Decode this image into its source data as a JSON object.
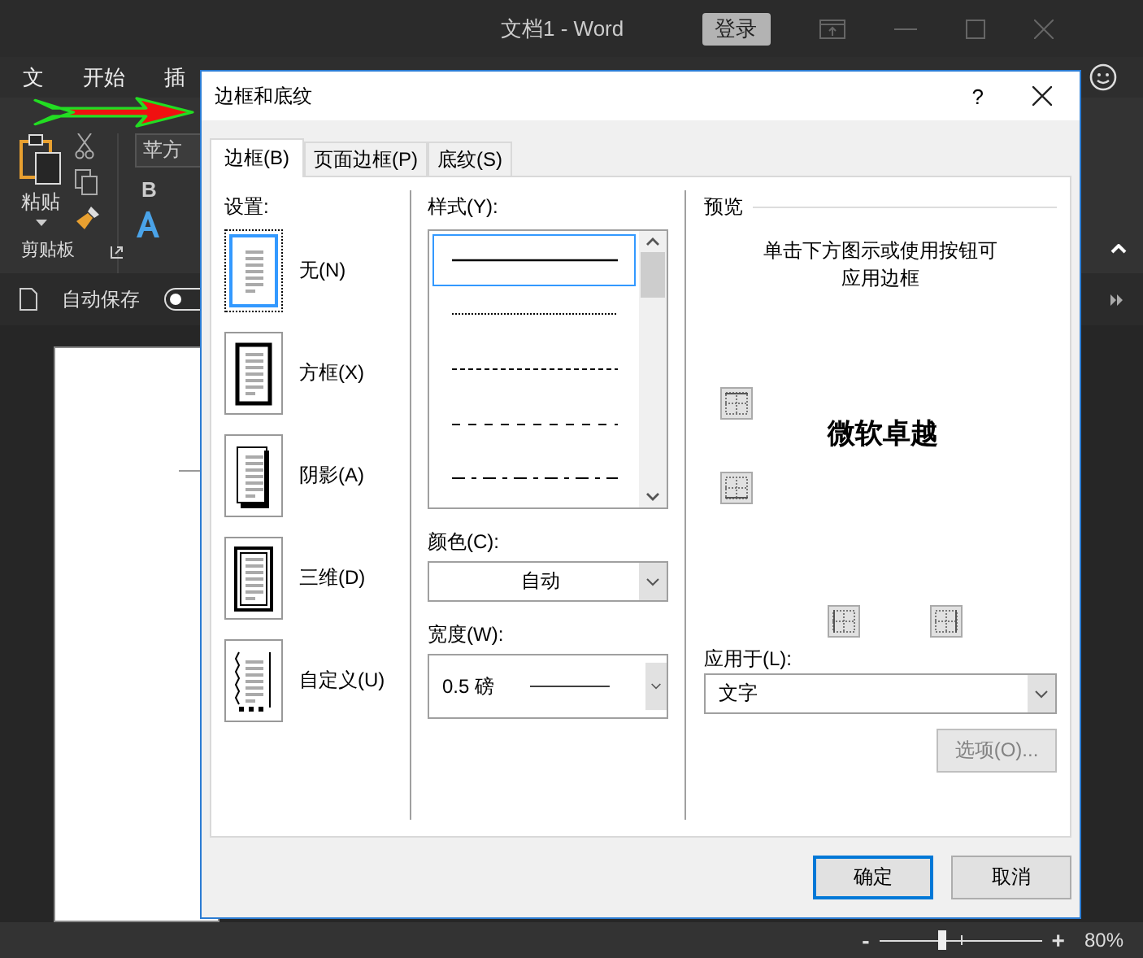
{
  "word_window": {
    "title": "文档1 - Word",
    "sign_in": "登录",
    "ribbon_tabs": [
      "文",
      "开始",
      "插"
    ],
    "font_box": "苹方",
    "paste": "粘贴",
    "clipboard_group": "剪贴板",
    "bold": "B",
    "autosave": "自动保存",
    "autosave_on": false,
    "zoom": {
      "minus": "-",
      "level": 0.38,
      "plus": "+",
      "percent": "80%"
    }
  },
  "annotation": {
    "kind": "arrow"
  },
  "dialog": {
    "title": "边框和底纹",
    "help": "?",
    "tabs": [
      {
        "label": "边框(B)",
        "selected": true
      },
      {
        "label": "页面边框(P)",
        "selected": false
      },
      {
        "label": "底纹(S)",
        "selected": false
      }
    ],
    "settings": {
      "label": "设置:",
      "items": [
        {
          "label": "无(N)",
          "kind": "none",
          "selected": true
        },
        {
          "label": "方框(X)",
          "kind": "box",
          "selected": false
        },
        {
          "label": "阴影(A)",
          "kind": "shadow",
          "selected": false
        },
        {
          "label": "三维(D)",
          "kind": "threed",
          "selected": false
        },
        {
          "label": "自定义(U)",
          "kind": "custom",
          "selected": false
        }
      ]
    },
    "style": {
      "label": "样式(Y):",
      "lines": [
        {
          "kind": "solid",
          "selected": true
        },
        {
          "kind": "dotted",
          "selected": false
        },
        {
          "kind": "fine-dashed",
          "selected": false
        },
        {
          "kind": "dashed",
          "selected": false
        },
        {
          "kind": "dash-dot",
          "selected": false
        }
      ]
    },
    "color": {
      "label": "颜色(C):",
      "value": "自动"
    },
    "width": {
      "label": "宽度(W):",
      "value": "0.5 磅"
    },
    "preview": {
      "label": "预览",
      "hint": "单击下方图示或使用按钮可应用边框",
      "sample": "微软卓越"
    },
    "apply_to": {
      "label": "应用于(L):",
      "value": "文字"
    },
    "options_button": {
      "label": "选项(O)...",
      "disabled": true
    },
    "buttons": [
      "确定",
      "取消"
    ]
  }
}
